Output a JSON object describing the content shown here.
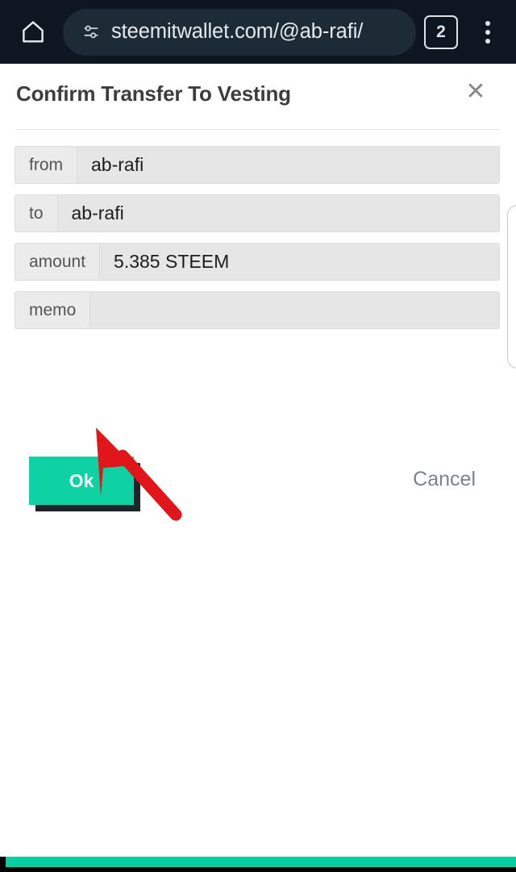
{
  "browser": {
    "home_icon": "home-icon",
    "site_settings_icon": "site-settings-icon",
    "url": "steemitwallet.com/@ab-rafi/",
    "tab_count": "2",
    "menu_icon": "kebab-menu-icon"
  },
  "dialog": {
    "title": "Confirm Transfer To Vesting",
    "close_icon": "✕",
    "fields": [
      {
        "label": "from",
        "value": "ab-rafi"
      },
      {
        "label": "to",
        "value": "ab-rafi"
      },
      {
        "label": "amount",
        "value": "5.385 STEEM"
      },
      {
        "label": "memo",
        "value": ""
      }
    ],
    "ok_label": "Ok",
    "cancel_label": "Cancel"
  },
  "annotation": {
    "arrow_color": "#e0161a",
    "points_to": "ok-button"
  },
  "colors": {
    "accent_teal": "#0ed2a3",
    "browser_bg": "#0e1621",
    "omnibox_bg": "#1d2b36",
    "field_label_bg": "#ebebeb",
    "field_value_bg": "#e6e6e6"
  }
}
